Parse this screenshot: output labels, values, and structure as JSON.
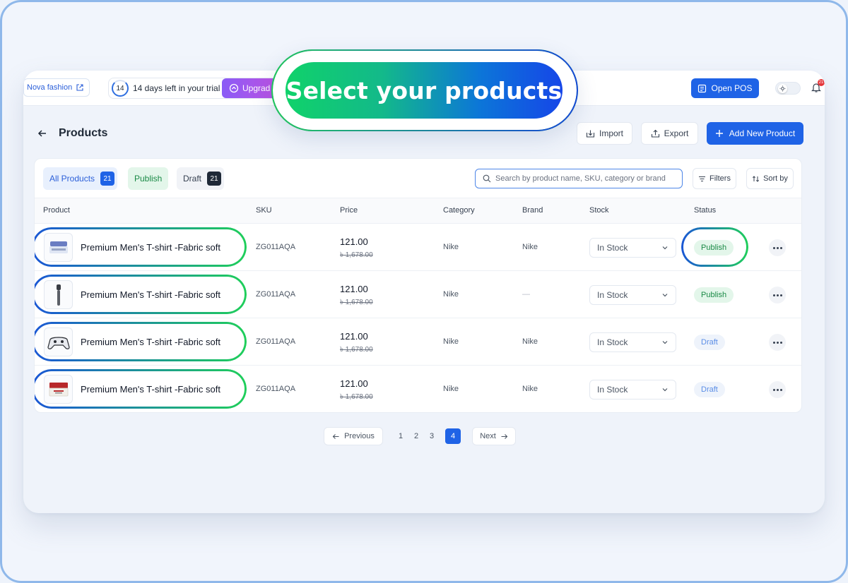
{
  "topbar": {
    "store_name": "Nova fashion",
    "trial_days": "14",
    "trial_text": "14 days left in your trial",
    "upgrade_label": "Upgrad",
    "open_pos_label": "Open POS",
    "notification_count": "21"
  },
  "callout": {
    "text": "Select your products"
  },
  "page": {
    "title": "Products",
    "import_label": "Import",
    "export_label": "Export",
    "add_label": "Add New Product"
  },
  "filters": {
    "tabs": [
      {
        "label": "All Products",
        "count": "21"
      },
      {
        "label": "Publish"
      },
      {
        "label": "Draft",
        "count": "21"
      }
    ],
    "search_placeholder": "Search by product name, SKU, category or brand",
    "filters_label": "Filters",
    "sort_label": "Sort by"
  },
  "table": {
    "columns": [
      "Product",
      "SKU",
      "Price",
      "Category",
      "Brand",
      "Stock",
      "Status"
    ],
    "rows": [
      {
        "name": "Premium Men's T-shirt -Fabric soft",
        "sku": "ZG011AQA",
        "price": "121.00",
        "old_price": "৳ 1,678.00",
        "category": "Nike",
        "brand": "Nike",
        "stock": "In Stock",
        "status": "Publish"
      },
      {
        "name": "Premium Men's T-shirt -Fabric soft",
        "sku": "ZG011AQA",
        "price": "121.00",
        "old_price": "৳ 1,678.00",
        "category": "Nike",
        "brand": "—",
        "stock": "In Stock",
        "status": "Publish"
      },
      {
        "name": "Premium Men's T-shirt -Fabric soft",
        "sku": "ZG011AQA",
        "price": "121.00",
        "old_price": "৳ 1,678.00",
        "category": "Nike",
        "brand": "Nike",
        "stock": "In Stock",
        "status": "Draft"
      },
      {
        "name": "Premium Men's T-shirt -Fabric soft",
        "sku": "ZG011AQA",
        "price": "121.00",
        "old_price": "৳ 1,678.00",
        "category": "Nike",
        "brand": "Nike",
        "stock": "In Stock",
        "status": "Draft"
      }
    ]
  },
  "pagination": {
    "previous_label": "Previous",
    "next_label": "Next",
    "pages": [
      "1",
      "2",
      "3",
      "4"
    ],
    "current": "4"
  },
  "colors": {
    "accent": "#1f63e6",
    "publish": "#1a8a46",
    "draft": "#5b8ee6",
    "highlight_start": "#1a56d6",
    "highlight_end": "#1fcf5a"
  }
}
